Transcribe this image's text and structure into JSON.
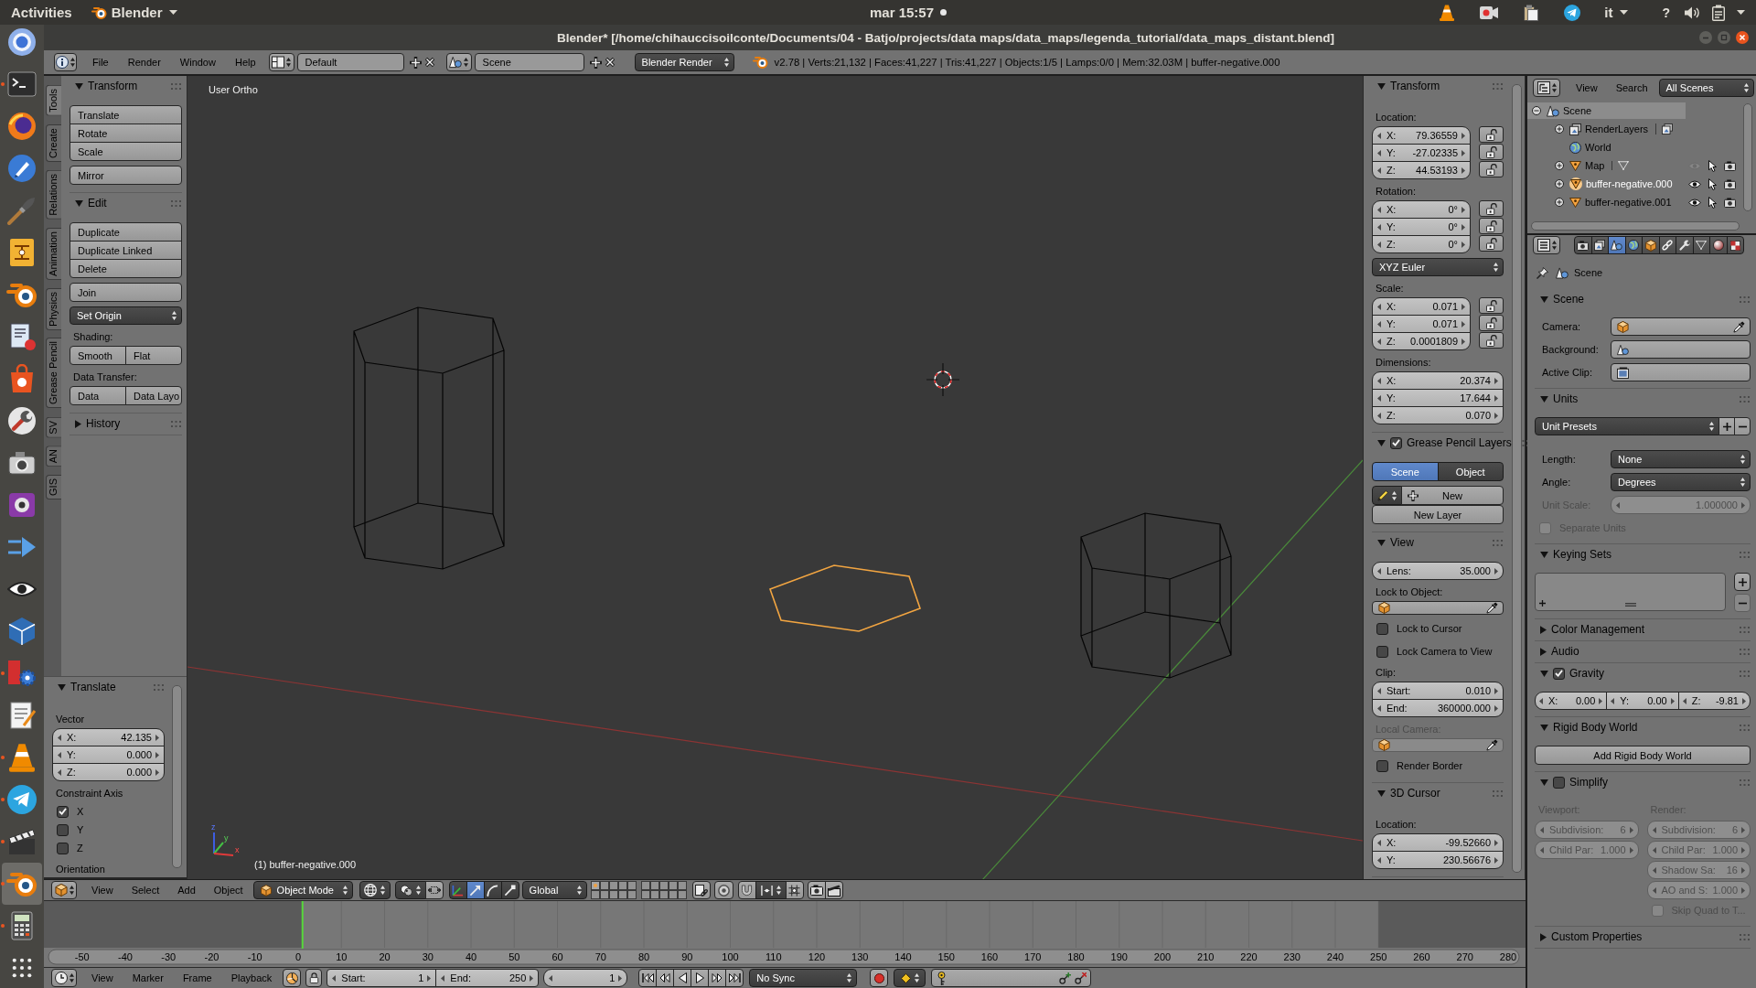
{
  "top_bar": {
    "activities": "Activities",
    "app_menu": "Blender",
    "clock": "mar 15:57",
    "keyboard_layout": "it",
    "help": "?"
  },
  "dock": [
    {
      "running": false,
      "selected": false
    },
    {
      "running": true,
      "selected": false
    },
    {
      "running": false,
      "selected": false
    },
    {
      "running": false,
      "selected": false
    },
    {
      "running": false,
      "selected": false
    },
    {
      "running": false,
      "selected": false
    },
    {
      "running": false,
      "selected": false
    },
    {
      "running": false,
      "selected": false
    },
    {
      "running": false,
      "selected": false
    },
    {
      "running": false,
      "selected": false
    },
    {
      "running": false,
      "selected": false
    },
    {
      "running": false,
      "selected": false
    },
    {
      "running": false,
      "selected": false
    },
    {
      "running": false,
      "selected": false
    },
    {
      "running": false,
      "selected": false
    },
    {
      "running": true,
      "selected": false
    },
    {
      "running": false,
      "selected": false
    },
    {
      "running": true,
      "selected": false
    },
    {
      "running": true,
      "selected": false
    },
    {
      "running": true,
      "selected": false
    },
    {
      "running": true,
      "selected": true
    },
    {
      "running": true,
      "selected": false
    },
    {
      "running": false,
      "selected": false
    }
  ],
  "window": {
    "title": "Blender* [/home/chihauccisoilconte/Documents/04 - Batjo/projects/data maps/data_maps/legenda_tutorial/data_maps_distant.blend]"
  },
  "info_header": {
    "menus": [
      "File",
      "Render",
      "Window",
      "Help"
    ],
    "layout": "Default",
    "scene": "Scene",
    "engine": "Blender Render",
    "stats": "v2.78 | Verts:21,132 | Faces:41,227 | Tris:41,227 | Objects:1/5 | Lamps:0/0 | Mem:32.03M | buffer-negative.000"
  },
  "tool_tabs": [
    {
      "label": "Tools",
      "selected": true
    },
    {
      "label": "Create",
      "selected": false
    },
    {
      "label": "Relations",
      "selected": false
    },
    {
      "label": "Animation",
      "selected": false
    },
    {
      "label": "Physics",
      "selected": false
    },
    {
      "label": "Grease Pencil",
      "selected": false
    },
    {
      "label": "SV",
      "selected": false
    },
    {
      "label": "AN",
      "selected": false
    },
    {
      "label": "GIS",
      "selected": false
    }
  ],
  "tool_shelf": [
    {
      "title": "Transform",
      "expanded": true,
      "items": [
        {
          "kind": "buttons",
          "labels": [
            "Translate",
            "Rotate",
            "Scale"
          ]
        },
        {
          "kind": "buttons",
          "labels": [
            "Mirror"
          ]
        }
      ]
    },
    {
      "title": "Edit",
      "expanded": true,
      "items": [
        {
          "kind": "buttons",
          "labels": [
            "Duplicate",
            "Duplicate Linked",
            "Delete"
          ]
        },
        {
          "kind": "buttons",
          "labels": [
            "Join"
          ]
        },
        {
          "kind": "dropdown",
          "label": "Set Origin"
        },
        {
          "kind": "label",
          "text": "Shading:"
        },
        {
          "kind": "row",
          "labels": [
            "Smooth",
            "Flat"
          ]
        },
        {
          "kind": "label",
          "text": "Data Transfer:"
        },
        {
          "kind": "row",
          "labels": [
            "Data",
            "Data Layo"
          ]
        }
      ]
    },
    {
      "title": "History",
      "expanded": false
    }
  ],
  "operator_panel": {
    "title": "Translate",
    "expanded": true,
    "items": [
      {
        "kind": "label",
        "text": "Vector"
      },
      {
        "kind": "vector",
        "fields": [
          {
            "label": "X:",
            "value": "42.135"
          },
          {
            "label": "Y:",
            "value": "0.000"
          },
          {
            "label": "Z:",
            "value": "0.000"
          }
        ]
      },
      {
        "kind": "label",
        "text": "Constraint Axis"
      },
      {
        "kind": "checkbox",
        "label": "X",
        "checked": true
      },
      {
        "kind": "checkbox",
        "label": "Y",
        "checked": false
      },
      {
        "kind": "checkbox",
        "label": "Z",
        "checked": false
      },
      {
        "kind": "label",
        "text": "Orientation"
      }
    ]
  },
  "viewport": {
    "view_name": "User Ortho",
    "object_info": "(1) buffer-negative.000",
    "axis_labels": [
      "z",
      "y",
      "x"
    ],
    "objects": [
      {
        "selected": false
      },
      {
        "selected": true
      },
      {
        "selected": false
      }
    ]
  },
  "n_panel": [
    {
      "title": "Transform",
      "expanded": true,
      "items": [
        {
          "kind": "label",
          "text": "Location:"
        },
        {
          "kind": "vector",
          "fields": [
            {
              "label": "X:",
              "value": "79.36559",
              "locked": false
            },
            {
              "label": "Y:",
              "value": "-27.02335",
              "locked": false
            },
            {
              "label": "Z:",
              "value": "44.53193",
              "locked": false
            }
          ]
        },
        {
          "kind": "label",
          "text": "Rotation:"
        },
        {
          "kind": "vector",
          "fields": [
            {
              "label": "X:",
              "value": "0°",
              "locked": false
            },
            {
              "label": "Y:",
              "value": "0°",
              "locked": false
            },
            {
              "label": "Z:",
              "value": "0°",
              "locked": false
            }
          ]
        },
        {
          "kind": "dropdown",
          "label": "XYZ Euler"
        },
        {
          "kind": "label",
          "text": "Scale:"
        },
        {
          "kind": "vector",
          "fields": [
            {
              "label": "X:",
              "value": "0.071",
              "locked": false
            },
            {
              "label": "Y:",
              "value": "0.071",
              "locked": false
            },
            {
              "label": "Z:",
              "value": "0.0001809",
              "locked": false
            }
          ]
        },
        {
          "kind": "label",
          "text": "Dimensions:"
        },
        {
          "kind": "vector",
          "fields": [
            {
              "label": "X:",
              "value": "20.374"
            },
            {
              "label": "Y:",
              "value": "17.644"
            },
            {
              "label": "Z:",
              "value": "0.070"
            }
          ]
        }
      ]
    },
    {
      "title": "Grease Pencil Layers",
      "expanded": true,
      "checked": true,
      "items": [
        {
          "kind": "toggle",
          "options": [
            {
              "label": "Scene",
              "selected": true
            },
            {
              "label": "Object",
              "selected": false
            }
          ]
        },
        {
          "kind": "new",
          "label": "New"
        },
        {
          "kind": "button",
          "label": "New Layer"
        }
      ]
    },
    {
      "title": "View",
      "expanded": true,
      "items": [
        {
          "kind": "number",
          "label": "Lens:",
          "value": "35.000",
          "disabled": false
        },
        {
          "kind": "label",
          "text": "Lock to Object:",
          "disabled": false
        },
        {
          "kind": "objectfield",
          "disabled": false
        },
        {
          "kind": "checkbox",
          "label": "Lock to Cursor",
          "checked": false,
          "disabled": false
        },
        {
          "kind": "checkbox",
          "label": "Lock Camera to View",
          "checked": false,
          "disabled": false
        },
        {
          "kind": "label",
          "text": "Clip:",
          "disabled": false
        },
        {
          "kind": "vector",
          "fields": [
            {
              "label": "Start:",
              "value": "0.010"
            },
            {
              "label": "End:",
              "value": "360000.000"
            }
          ],
          "disabled": false
        },
        {
          "kind": "label",
          "text": "Local Camera:",
          "disabled": true
        },
        {
          "kind": "objectfield",
          "disabled": true
        },
        {
          "kind": "checkbox",
          "label": "Render Border",
          "checked": false,
          "disabled": false
        }
      ]
    },
    {
      "title": "3D Cursor",
      "expanded": true,
      "items": [
        {
          "kind": "label",
          "text": "Location:"
        },
        {
          "kind": "vector",
          "fields": [
            {
              "label": "X:",
              "value": "-99.52660"
            },
            {
              "label": "Y:",
              "value": "230.56676"
            }
          ]
        }
      ]
    }
  ],
  "view3d_header": {
    "menus": [
      "View",
      "Select",
      "Add",
      "Object"
    ],
    "mode": "Object Mode",
    "manipulators": [
      {
        "selected": false
      },
      {
        "selected": true
      },
      {
        "selected": false
      },
      {
        "selected": false
      }
    ],
    "orientation": "Global",
    "layers": [
      {
        "selected": true,
        "occupied": true
      },
      {
        "selected": false,
        "occupied": false
      },
      {
        "selected": false,
        "occupied": false
      },
      {
        "selected": false,
        "occupied": false
      },
      {
        "selected": false,
        "occupied": false
      },
      {
        "selected": false,
        "occupied": false
      },
      {
        "selected": false,
        "occupied": false
      },
      {
        "selected": false,
        "occupied": false
      },
      {
        "selected": false,
        "occupied": false
      },
      {
        "selected": false,
        "occupied": false
      },
      {
        "selected": false,
        "occupied": false
      },
      {
        "selected": false,
        "occupied": false
      },
      {
        "selected": false,
        "occupied": false
      },
      {
        "selected": false,
        "occupied": false
      },
      {
        "selected": false,
        "occupied": false
      },
      {
        "selected": false,
        "occupied": false
      },
      {
        "selected": false,
        "occupied": false
      },
      {
        "selected": false,
        "occupied": false
      },
      {
        "selected": false,
        "occupied": false
      },
      {
        "selected": false,
        "occupied": false
      }
    ]
  },
  "timeline": {
    "ruler": [
      "-50",
      "-40",
      "-30",
      "-20",
      "-10",
      "0",
      "10",
      "20",
      "30",
      "40",
      "50",
      "60",
      "70",
      "80",
      "90",
      "100",
      "110",
      "120",
      "130",
      "140",
      "150",
      "160",
      "170",
      "180",
      "190",
      "200",
      "210",
      "220",
      "230",
      "240",
      "250",
      "260",
      "270",
      "280"
    ],
    "menus": [
      "View",
      "Marker",
      "Frame",
      "Playback"
    ],
    "start": {
      "label": "Start:",
      "value": "1"
    },
    "end": {
      "label": "End:",
      "value": "250"
    },
    "current_frame": "1",
    "sync": "No Sync"
  },
  "outliner": {
    "menus": [
      "View",
      "Search"
    ],
    "display_mode": "All Scenes",
    "tree": [
      {
        "label": "Scene",
        "kind": "scene",
        "expanded": true,
        "selected": true,
        "active": false,
        "children": [
          {
            "label": "RenderLayers",
            "kind": "renderlayers",
            "expanded": false,
            "selected": false,
            "active": false
          },
          {
            "label": "World",
            "kind": "world",
            "selected": false,
            "active": false
          },
          {
            "label": "Map",
            "kind": "object",
            "expanded": false,
            "selected": false,
            "active": false,
            "visible": false
          },
          {
            "label": "buffer-negative.000",
            "kind": "object",
            "expanded": false,
            "selected": false,
            "active": true,
            "visible": true
          },
          {
            "label": "buffer-negative.001",
            "kind": "object",
            "expanded": false,
            "selected": false,
            "active": false,
            "visible": true
          }
        ]
      }
    ]
  },
  "properties": {
    "tabs": [
      {
        "selected": false
      },
      {
        "selected": false
      },
      {
        "selected": true
      },
      {
        "selected": false
      },
      {
        "selected": false
      },
      {
        "selected": false
      },
      {
        "selected": false
      },
      {
        "selected": false
      },
      {
        "selected": false
      },
      {
        "selected": false
      }
    ],
    "context": "Scene",
    "panels": [
      {
        "title": "Scene",
        "expanded": true,
        "items": [
          {
            "kind": "objectfield",
            "caption": "Camera:"
          },
          {
            "kind": "scenefield",
            "caption": "Background:"
          },
          {
            "kind": "clipfield",
            "caption": "Active Clip:"
          }
        ]
      },
      {
        "title": "Units",
        "expanded": true,
        "items": [
          {
            "kind": "presets",
            "label": "Unit Presets",
            "disabled": false
          },
          {
            "kind": "dropdown",
            "caption": "Length:",
            "label": "None",
            "disabled": false
          },
          {
            "kind": "dropdown",
            "caption": "Angle:",
            "label": "Degrees",
            "disabled": false
          },
          {
            "kind": "number",
            "caption": "Unit Scale:",
            "value": "1.000000",
            "disabled": true
          },
          {
            "kind": "checkbox",
            "label": "Separate Units",
            "checked": false,
            "disabled": true
          }
        ]
      },
      {
        "title": "Keying Sets",
        "expanded": true,
        "items": [
          {
            "kind": "list"
          }
        ]
      },
      {
        "title": "Color Management",
        "expanded": false
      },
      {
        "title": "Audio",
        "expanded": false
      },
      {
        "title": "Gravity",
        "expanded": true,
        "checked": true,
        "items": [
          {
            "kind": "vectorrow",
            "fields": [
              {
                "label": "X:",
                "value": "0.00"
              },
              {
                "label": "Y:",
                "value": "0.00"
              },
              {
                "label": "Z:",
                "value": "-9.81"
              }
            ]
          }
        ]
      },
      {
        "title": "Rigid Body World",
        "expanded": true,
        "items": [
          {
            "kind": "button",
            "label": "Add Rigid Body World"
          }
        ]
      },
      {
        "title": "Simplify",
        "expanded": true,
        "checked": false,
        "items": [
          {
            "kind": "columns",
            "columns": [
              {
                "items": [
                  {
                    "kind": "label",
                    "text": "Viewport:"
                  },
                  {
                    "kind": "number",
                    "label": "Subdivision:",
                    "value": "6"
                  },
                  {
                    "kind": "number",
                    "label": "Child Par:",
                    "value": "1.000"
                  }
                ]
              },
              {
                "items": [
                  {
                    "kind": "label",
                    "text": "Render:"
                  },
                  {
                    "kind": "number",
                    "label": "Subdivision:",
                    "value": "6"
                  },
                  {
                    "kind": "number",
                    "label": "Child Par:",
                    "value": "1.000"
                  },
                  {
                    "kind": "number",
                    "label": "Shadow Sa:",
                    "value": "16"
                  },
                  {
                    "kind": "number",
                    "label": "AO and S:",
                    "value": "1.000"
                  },
                  {
                    "kind": "checkbox",
                    "label": "Skip Quad to T...",
                    "checked": false
                  }
                ]
              }
            ]
          }
        ]
      },
      {
        "title": "Custom Properties",
        "expanded": false
      }
    ]
  }
}
